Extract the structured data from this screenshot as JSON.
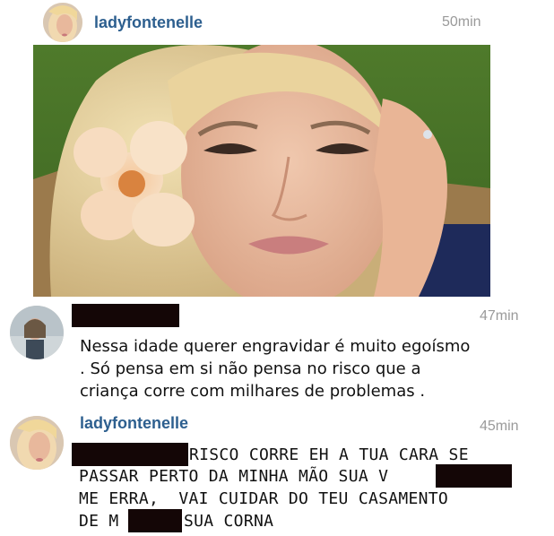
{
  "post": {
    "username": "ladyfontenelle",
    "timestamp": "50min",
    "avatar_icon": "user-avatar-photo"
  },
  "comments": [
    {
      "username_redacted": true,
      "timestamp": "47min",
      "avatar_icon": "user-avatar-photo",
      "lines": [
        "Nessa idade querer engravidar é muito egoísmo",
        ". Só pensa em si não pensa no risco que a",
        "criança corre com milhares de problemas ."
      ]
    },
    {
      "username": "ladyfontenelle",
      "timestamp": "45min",
      "avatar_icon": "user-avatar-photo",
      "line1_tail": "RISCO CORRE EH A TUA CARA SE",
      "line2_head": "PASSAR PERTO DA MINHA MÃO SUA V",
      "line3": "ME ERRA,  VAI CUIDAR DO TEU CASAMENTO",
      "line4_head": "DE M",
      "line4_tail": "SUA CORNA"
    }
  ],
  "colors": {
    "username": "#2d5f8f",
    "timestamp": "#9a9a9a",
    "redaction": "#140606"
  }
}
